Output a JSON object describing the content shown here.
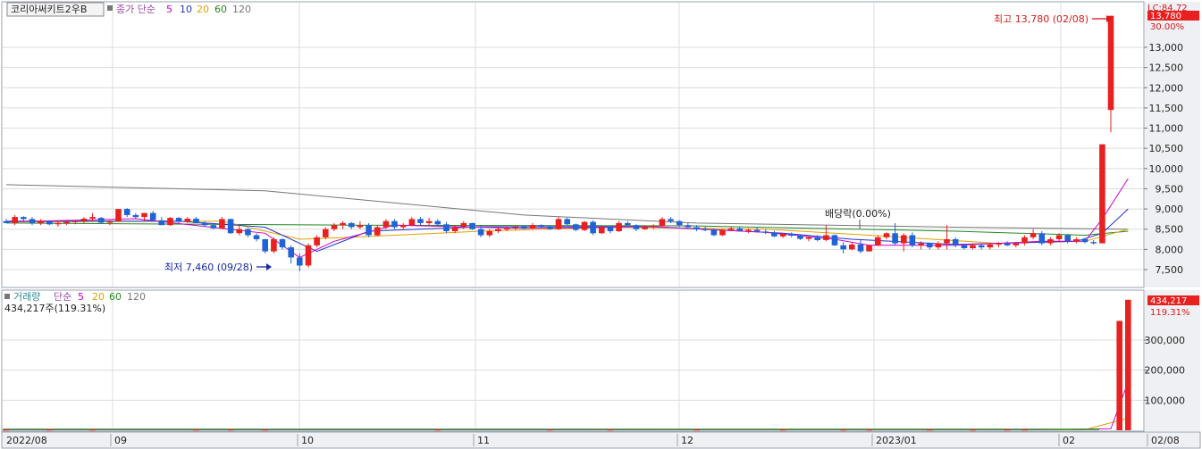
{
  "price_panel": {
    "stock_name": "코리아써키트2우B",
    "ma_legend": {
      "label": "종가 단순",
      "periods": [
        {
          "text": "5",
          "color": "#cc00cc"
        },
        {
          "text": "10",
          "color": "#2233cc"
        },
        {
          "text": "20",
          "color": "#e3a100"
        },
        {
          "text": "60",
          "color": "#228822"
        },
        {
          "text": "120",
          "color": "#777777"
        }
      ]
    },
    "lc_text": "LC:84.72",
    "current_price_badge": "13,780",
    "change_pct": "30.00%",
    "high_annotation": "최고 13,780 (02/08)",
    "low_annotation": "최저 7,460 (09/28)",
    "dividend_annotation": "배당락(0.00%)"
  },
  "volume_panel": {
    "legend_label": "거래량",
    "ma_label": "단순",
    "periods": [
      {
        "text": "5",
        "color": "#cc00cc"
      },
      {
        "text": "20",
        "color": "#e3a100"
      },
      {
        "text": "60",
        "color": "#228822"
      },
      {
        "text": "120",
        "color": "#777777"
      }
    ],
    "current_text": "434,217주(119.31%)",
    "volume_badge": "434,217",
    "volume_pct": "119.31%"
  },
  "colors": {
    "up": "#e8201f",
    "down": "#1f63d6",
    "grid": "#dcdcdc",
    "axis_bg": "#eef0f4"
  },
  "chart_data": [
    {
      "type": "candlestick",
      "title": "코리아써키트2우B",
      "y_ticks": [
        7500,
        8000,
        8500,
        9000,
        9500,
        10000,
        10500,
        11000,
        11500,
        12000,
        12500,
        13000
      ],
      "y_tick_labels": [
        "7,500",
        "8,000",
        "8,500",
        "9,000",
        "9,500",
        "10,000",
        "10,500",
        "11,000",
        "11,500",
        "12,000",
        "12,500",
        "13,000"
      ],
      "ylim": [
        7000,
        13950
      ],
      "x_labels": [
        "2022/08",
        "09",
        "10",
        "11",
        "12",
        "2023/01",
        "02",
        "02/08"
      ],
      "candles": [
        [
          8700,
          8750,
          8650,
          8650
        ],
        [
          8650,
          8850,
          8600,
          8800
        ],
        [
          8800,
          8820,
          8700,
          8750
        ],
        [
          8750,
          8800,
          8600,
          8650
        ],
        [
          8650,
          8750,
          8600,
          8700
        ],
        [
          8700,
          8720,
          8600,
          8620
        ],
        [
          8620,
          8700,
          8560,
          8650
        ],
        [
          8650,
          8700,
          8600,
          8680
        ],
        [
          8680,
          8720,
          8620,
          8700
        ],
        [
          8700,
          8800,
          8650,
          8760
        ],
        [
          8760,
          8900,
          8700,
          8800
        ],
        [
          8780,
          8800,
          8650,
          8660
        ],
        [
          8660,
          8720,
          8600,
          8700
        ],
        [
          8700,
          8950,
          8680,
          9000
        ],
        [
          9000,
          9020,
          8800,
          8850
        ],
        [
          8850,
          8900,
          8750,
          8800
        ],
        [
          8800,
          8900,
          8700,
          8900
        ],
        [
          8900,
          8950,
          8700,
          8720
        ],
        [
          8720,
          8800,
          8600,
          8600
        ],
        [
          8600,
          8800,
          8580,
          8780
        ],
        [
          8780,
          8800,
          8650,
          8680
        ],
        [
          8680,
          8800,
          8650,
          8760
        ],
        [
          8760,
          8800,
          8650,
          8650
        ],
        [
          8650,
          8700,
          8550,
          8600
        ],
        [
          8600,
          8650,
          8500,
          8520
        ],
        [
          8520,
          8800,
          8500,
          8750
        ],
        [
          8750,
          8760,
          8380,
          8400
        ],
        [
          8400,
          8600,
          8350,
          8500
        ],
        [
          8500,
          8520,
          8300,
          8350
        ],
        [
          8350,
          8400,
          8200,
          8250
        ],
        [
          8250,
          8260,
          7900,
          7950
        ],
        [
          7950,
          8300,
          7900,
          8250
        ],
        [
          8250,
          8280,
          8000,
          8050
        ],
        [
          8050,
          8100,
          7650,
          7800
        ],
        [
          7800,
          7900,
          7460,
          7600
        ],
        [
          7600,
          8150,
          7550,
          8100
        ],
        [
          8100,
          8350,
          8050,
          8300
        ],
        [
          8300,
          8550,
          8250,
          8500
        ],
        [
          8500,
          8650,
          8450,
          8600
        ],
        [
          8600,
          8700,
          8500,
          8650
        ],
        [
          8650,
          8680,
          8500,
          8550
        ],
        [
          8550,
          8700,
          8500,
          8600
        ],
        [
          8600,
          8650,
          8300,
          8350
        ],
        [
          8350,
          8600,
          8330,
          8550
        ],
        [
          8550,
          8750,
          8500,
          8700
        ],
        [
          8700,
          8750,
          8500,
          8550
        ],
        [
          8550,
          8650,
          8500,
          8600
        ],
        [
          8600,
          8800,
          8580,
          8750
        ],
        [
          8750,
          8800,
          8600,
          8650
        ],
        [
          8650,
          8780,
          8600,
          8700
        ],
        [
          8700,
          8750,
          8580,
          8620
        ],
        [
          8620,
          8680,
          8400,
          8450
        ],
        [
          8450,
          8600,
          8400,
          8550
        ],
        [
          8550,
          8700,
          8500,
          8650
        ],
        [
          8650,
          8660,
          8480,
          8500
        ],
        [
          8500,
          8600,
          8300,
          8350
        ],
        [
          8350,
          8500,
          8300,
          8450
        ],
        [
          8450,
          8550,
          8400,
          8500
        ],
        [
          8500,
          8560,
          8450,
          8520
        ],
        [
          8520,
          8600,
          8480,
          8550
        ],
        [
          8550,
          8600,
          8500,
          8520
        ],
        [
          8520,
          8650,
          8500,
          8600
        ],
        [
          8600,
          8620,
          8520,
          8560
        ],
        [
          8560,
          8600,
          8480,
          8500
        ],
        [
          8500,
          8800,
          8480,
          8750
        ],
        [
          8750,
          8780,
          8600,
          8620
        ],
        [
          8620,
          8640,
          8450,
          8480
        ],
        [
          8480,
          8700,
          8450,
          8680
        ],
        [
          8680,
          8720,
          8350,
          8400
        ],
        [
          8400,
          8600,
          8380,
          8550
        ],
        [
          8550,
          8580,
          8400,
          8450
        ],
        [
          8450,
          8700,
          8430,
          8650
        ],
        [
          8650,
          8700,
          8550,
          8600
        ],
        [
          8600,
          8620,
          8450,
          8500
        ],
        [
          8500,
          8600,
          8480,
          8560
        ],
        [
          8560,
          8620,
          8500,
          8580
        ],
        [
          8580,
          8800,
          8550,
          8750
        ],
        [
          8750,
          8800,
          8650,
          8700
        ],
        [
          8700,
          8720,
          8550,
          8600
        ],
        [
          8600,
          8650,
          8500,
          8550
        ],
        [
          8550,
          8600,
          8450,
          8500
        ],
        [
          8500,
          8560,
          8450,
          8480
        ],
        [
          8480,
          8500,
          8330,
          8350
        ],
        [
          8350,
          8500,
          8330,
          8480
        ],
        [
          8480,
          8560,
          8450,
          8520
        ],
        [
          8520,
          8560,
          8450,
          8460
        ],
        [
          8460,
          8520,
          8400,
          8480
        ],
        [
          8480,
          8550,
          8420,
          8440
        ],
        [
          8440,
          8500,
          8380,
          8420
        ],
        [
          8420,
          8460,
          8300,
          8320
        ],
        [
          8320,
          8400,
          8280,
          8380
        ],
        [
          8380,
          8420,
          8300,
          8340
        ],
        [
          8340,
          8380,
          8230,
          8260
        ],
        [
          8260,
          8320,
          8200,
          8300
        ],
        [
          8300,
          8350,
          8200,
          8230
        ],
        [
          8230,
          8600,
          8200,
          8350
        ],
        [
          8350,
          8370,
          8080,
          8100
        ],
        [
          8100,
          8180,
          7900,
          8000
        ],
        [
          8000,
          8160,
          7980,
          8120
        ],
        [
          8120,
          8250,
          7900,
          7950
        ],
        [
          7950,
          8050,
          7950,
          8100
        ],
        [
          8100,
          8350,
          8080,
          8300
        ],
        [
          8300,
          8420,
          8250,
          8400
        ],
        [
          8400,
          8650,
          8100,
          8150
        ],
        [
          8150,
          8400,
          7950,
          8350
        ],
        [
          8350,
          8420,
          8050,
          8100
        ],
        [
          8100,
          8200,
          8000,
          8150
        ],
        [
          8150,
          8170,
          8000,
          8050
        ],
        [
          8050,
          8200,
          8000,
          8150
        ],
        [
          8150,
          8600,
          8000,
          8250
        ],
        [
          8250,
          8300,
          8050,
          8100
        ],
        [
          8100,
          8120,
          8000,
          8030
        ],
        [
          8030,
          8150,
          8000,
          8100
        ],
        [
          8100,
          8120,
          8000,
          8050
        ],
        [
          8050,
          8150,
          8000,
          8120
        ],
        [
          8120,
          8180,
          8050,
          8150
        ],
        [
          8150,
          8200,
          8080,
          8100
        ],
        [
          8100,
          8180,
          8050,
          8150
        ],
        [
          8150,
          8350,
          8100,
          8300
        ],
        [
          8300,
          8500,
          8250,
          8400
        ],
        [
          8400,
          8450,
          8100,
          8150
        ],
        [
          8150,
          8300,
          8100,
          8250
        ],
        [
          8250,
          8400,
          8200,
          8350
        ],
        [
          8350,
          8380,
          8150,
          8200
        ],
        [
          8200,
          8300,
          8150,
          8250
        ],
        [
          8250,
          8280,
          8150,
          8180
        ],
        [
          8180,
          8230,
          8120,
          8150
        ],
        [
          8150,
          10600,
          8150,
          10600
        ],
        [
          11450,
          13780,
          10900,
          13780
        ]
      ],
      "ma5": [
        [
          0,
          8680
        ],
        [
          15,
          8760
        ],
        [
          30,
          8400
        ],
        [
          34,
          7800
        ],
        [
          38,
          8200
        ],
        [
          45,
          8600
        ],
        [
          60,
          8520
        ],
        [
          75,
          8560
        ],
        [
          88,
          8420
        ],
        [
          96,
          8250
        ],
        [
          100,
          8100
        ],
        [
          110,
          8100
        ],
        [
          120,
          8200
        ],
        [
          125,
          8200
        ],
        [
          127,
          8750
        ],
        [
          130,
          9750
        ]
      ],
      "ma10": [
        [
          0,
          8700
        ],
        [
          20,
          8700
        ],
        [
          30,
          8550
        ],
        [
          36,
          7950
        ],
        [
          42,
          8450
        ],
        [
          55,
          8560
        ],
        [
          75,
          8560
        ],
        [
          90,
          8400
        ],
        [
          98,
          8250
        ],
        [
          110,
          8120
        ],
        [
          124,
          8200
        ],
        [
          127,
          8400
        ],
        [
          130,
          9000
        ]
      ],
      "ma20": [
        [
          0,
          8680
        ],
        [
          25,
          8700
        ],
        [
          34,
          8250
        ],
        [
          40,
          8300
        ],
        [
          55,
          8450
        ],
        [
          70,
          8550
        ],
        [
          88,
          8500
        ],
        [
          100,
          8350
        ],
        [
          115,
          8150
        ],
        [
          125,
          8200
        ],
        [
          130,
          8500
        ]
      ],
      "ma60": [
        [
          0,
          8650
        ],
        [
          40,
          8600
        ],
        [
          80,
          8580
        ],
        [
          110,
          8450
        ],
        [
          125,
          8350
        ],
        [
          130,
          8450
        ]
      ],
      "ma120": [
        [
          0,
          9600
        ],
        [
          30,
          9450
        ],
        [
          60,
          8850
        ],
        [
          80,
          8650
        ],
        [
          110,
          8550
        ],
        [
          130,
          8500
        ]
      ]
    },
    {
      "type": "volume_bar",
      "title": "거래량",
      "y_ticks": [
        100000,
        200000,
        300000
      ],
      "y_tick_labels": [
        "100,000",
        "200,000",
        "300,000"
      ],
      "ylim": [
        0,
        440000
      ],
      "x_labels": [
        "2022/08",
        "09",
        "10",
        "11",
        "12",
        "2023/01",
        "02",
        "02/08"
      ],
      "bars": [
        [
          0,
          2000
        ],
        [
          5,
          1500
        ],
        [
          10,
          1800
        ],
        [
          22,
          1200
        ],
        [
          26,
          2500
        ],
        [
          30,
          1500
        ],
        [
          50,
          1200
        ],
        [
          63,
          1500
        ],
        [
          70,
          1000
        ],
        [
          80,
          1300
        ],
        [
          90,
          1500
        ],
        [
          97,
          1800
        ],
        [
          100,
          3000
        ],
        [
          107,
          2000
        ],
        [
          112,
          1800
        ],
        [
          116,
          1500
        ],
        [
          118,
          2000
        ],
        [
          129,
          364000
        ],
        [
          130,
          434217
        ]
      ],
      "ma5": [
        [
          0,
          1500
        ],
        [
          120,
          1800
        ],
        [
          128,
          5000
        ],
        [
          130,
          160000
        ]
      ],
      "ma20": [
        [
          0,
          1500
        ],
        [
          125,
          1800
        ],
        [
          130,
          40000
        ]
      ]
    }
  ]
}
